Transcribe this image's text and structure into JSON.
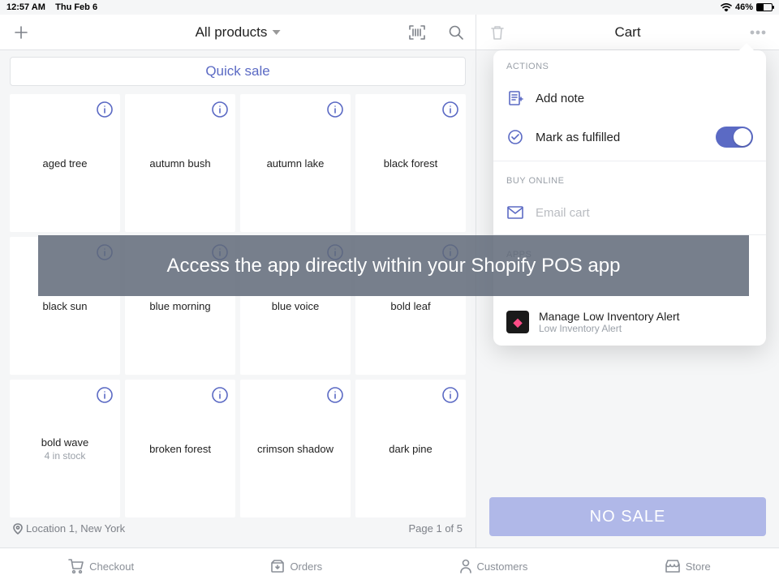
{
  "status": {
    "time": "12:57 AM",
    "date": "Thu Feb 6",
    "battery": "46%"
  },
  "header": {
    "title": "All products",
    "cart_title": "Cart"
  },
  "quick_sale_label": "Quick sale",
  "products": [
    {
      "name": "aged tree"
    },
    {
      "name": "autumn bush"
    },
    {
      "name": "autumn lake"
    },
    {
      "name": "black forest"
    },
    {
      "name": "black sun"
    },
    {
      "name": "blue morning"
    },
    {
      "name": "blue voice"
    },
    {
      "name": "bold leaf"
    },
    {
      "name": "bold wave",
      "stock": "4 in stock"
    },
    {
      "name": "broken forest"
    },
    {
      "name": "crimson shadow"
    },
    {
      "name": "dark pine"
    }
  ],
  "footer": {
    "location": "Location 1, New York",
    "page": "Page 1 of 5"
  },
  "popover": {
    "actions_label": "ACTIONS",
    "add_note": "Add note",
    "mark_fulfilled": "Mark as fulfilled",
    "buy_online_label": "BUY ONLINE",
    "email_cart_placeholder": "Email cart",
    "apps_label": "APPS",
    "app_title": "Manage Low Inventory Alert",
    "app_subtitle": "Low Inventory Alert"
  },
  "no_sale": "NO SALE",
  "banner": "Access the app directly within your Shopify POS app",
  "tabs": {
    "checkout": "Checkout",
    "orders": "Orders",
    "customers": "Customers",
    "store": "Store"
  }
}
